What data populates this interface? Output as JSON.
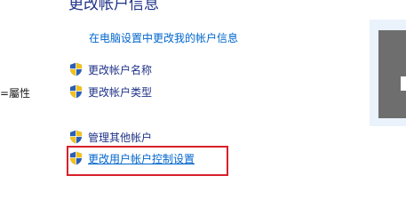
{
  "section": {
    "heading": "更改帐户信息",
    "pc_settings_link": "在电脑设置中更改我的帐户信息"
  },
  "left_panel": {
    "partial_text": "=屬性"
  },
  "actions": [
    {
      "label": "更改帐户名称",
      "icon": "uac-shield-icon"
    },
    {
      "label": "更改帐户类型",
      "icon": "uac-shield-icon"
    },
    {
      "label": "管理其他帐户",
      "icon": "uac-shield-icon"
    },
    {
      "label": "更改用户帐户控制设置",
      "icon": "uac-shield-icon"
    }
  ],
  "colors": {
    "link": "#0066cc",
    "heading": "#1e3287",
    "highlight": "#d9202a",
    "panel": "#eaf2fb"
  }
}
